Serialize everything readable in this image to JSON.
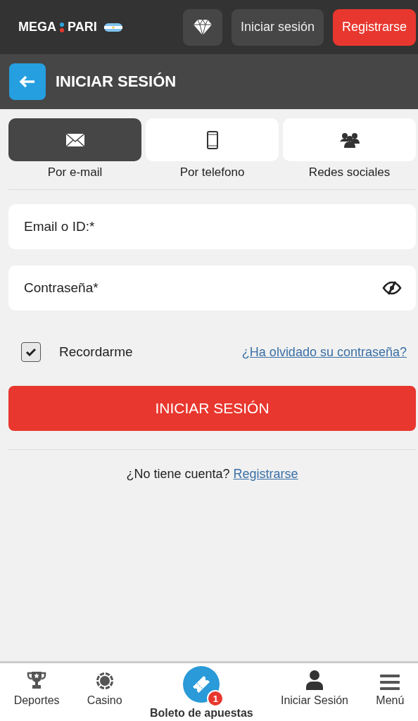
{
  "header": {
    "logo": [
      "MEGA",
      "PARI"
    ],
    "login_button": "Iniciar sesión",
    "register_button": "Registrarse"
  },
  "page_title": "INICIAR SESIÓN",
  "tabs": [
    {
      "kind": "email",
      "label": "Por e-mail",
      "selected": true
    },
    {
      "kind": "phone",
      "label": "Por telefono",
      "selected": false
    },
    {
      "kind": "social",
      "label": "Redes sociales",
      "selected": false
    }
  ],
  "fields": [
    {
      "placeholder": "Email o ID:*",
      "kind": "text"
    },
    {
      "placeholder": "Contraseña*",
      "kind": "password"
    }
  ],
  "remember": {
    "label": "Recordarme",
    "checked": true
  },
  "forgot_link": "¿Ha olvidado su contraseña?",
  "submit_button": "INICIAR SESIÓN",
  "signup": {
    "text": "¿No tiene cuenta?",
    "link": "Registrarse"
  },
  "bottom_nav": [
    {
      "kind": "trophy",
      "label": "Deportes",
      "selected": false
    },
    {
      "kind": "chip",
      "label": "Casino",
      "selected": false
    },
    {
      "kind": "ticket",
      "label": "Boleto de apuestas",
      "selected": true,
      "badge": "1"
    },
    {
      "kind": "user",
      "label": "Iniciar Sesión",
      "selected": false
    },
    {
      "kind": "menu",
      "label": "Menú",
      "selected": false
    }
  ]
}
